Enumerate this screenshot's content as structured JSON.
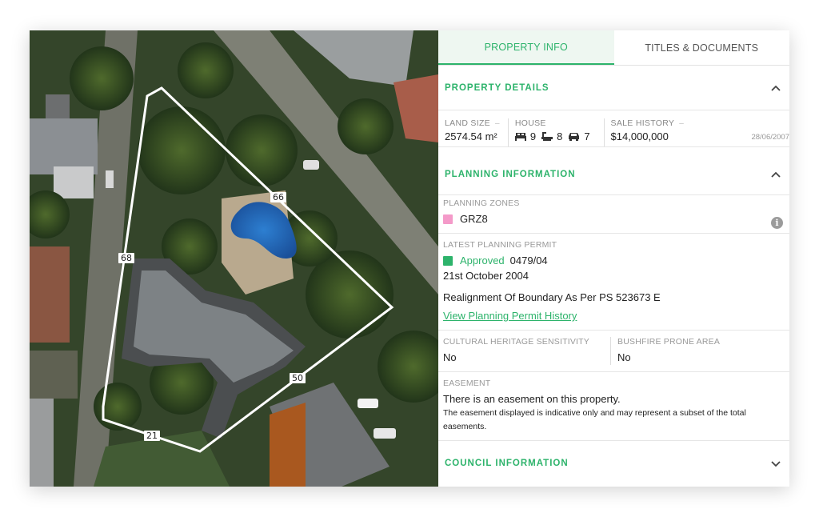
{
  "map": {
    "lot_labels": {
      "north": "66",
      "west": "68",
      "east": "50",
      "south": "21"
    }
  },
  "tabs": [
    {
      "label": "PROPERTY INFO",
      "active": true
    },
    {
      "label": "TITLES & DOCUMENTS",
      "active": false
    }
  ],
  "property_details": {
    "title": "PROPERTY DETAILS",
    "land_size_label": "LAND SIZE",
    "land_size_dash": "–",
    "land_size_value": "2574.54 m²",
    "house_label": "HOUSE",
    "bedrooms": "9",
    "bathrooms": "8",
    "parking": "7",
    "sale_history_label": "SALE HISTORY",
    "sale_history_dash": "–",
    "sale_price": "$14,000,000",
    "sale_date": "28/06/2007"
  },
  "planning": {
    "title": "PLANNING INFORMATION",
    "zones_label": "PLANNING ZONES",
    "zone": "GRZ8",
    "zone_color": "#f49ac9",
    "permit_label": "LATEST PLANNING PERMIT",
    "permit_status": "Approved",
    "permit_status_color": "#2db36b",
    "permit_number": "0479/04",
    "permit_date": "21st October 2004",
    "permit_description": "Realignment Of Boundary As Per PS 523673 E",
    "permit_history_link": "View Planning Permit History",
    "heritage_label": "CULTURAL HERITAGE SENSITIVITY",
    "heritage_value": "No",
    "bushfire_label": "BUSHFIRE PRONE AREA",
    "bushfire_value": "No",
    "easement_label": "EASEMENT",
    "easement_value": "There is an easement on this property.",
    "easement_note": "The easement displayed is indicative only and may represent a subset of the total easements."
  },
  "council": {
    "title": "COUNCIL INFORMATION"
  },
  "colors": {
    "accent": "#2db36b",
    "info_icon": "#9b9b9b"
  },
  "icons": [
    "chevron-up-icon",
    "bed-icon",
    "bath-icon",
    "car-icon",
    "info-icon",
    "chevron-down-icon"
  ]
}
